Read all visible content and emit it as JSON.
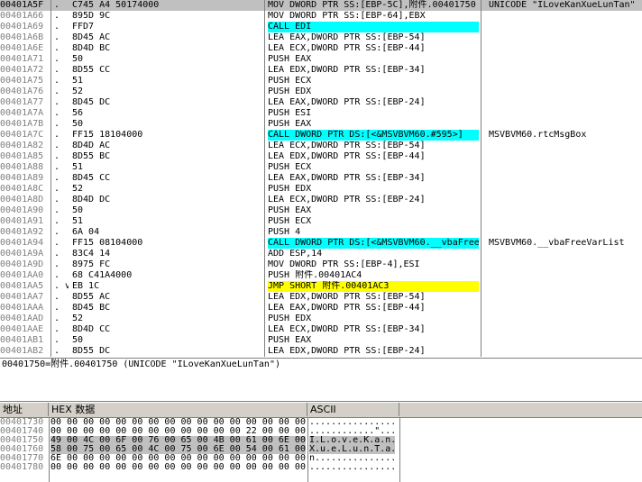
{
  "disasm": {
    "rows": [
      {
        "addr": "00401A5F",
        "mark": ".",
        "hex": "C745 A4 50174000",
        "asm": "MOV DWORD PTR SS:[EBP-5C],附件.00401750",
        "comment": "UNICODE \"ILoveKanXueLunTan\"",
        "selected": true,
        "hl": ""
      },
      {
        "addr": "00401A66",
        "mark": ".",
        "hex": "895D 9C",
        "asm": "MOV DWORD PTR SS:[EBP-64],EBX",
        "comment": "",
        "selected": false,
        "hl": ""
      },
      {
        "addr": "00401A69",
        "mark": ".",
        "hex": "FFD7",
        "asm": "CALL EDI",
        "comment": "",
        "selected": false,
        "hl": "cyan"
      },
      {
        "addr": "00401A6B",
        "mark": ".",
        "hex": "8D45 AC",
        "asm": "LEA EAX,DWORD PTR SS:[EBP-54]",
        "comment": "",
        "selected": false,
        "hl": ""
      },
      {
        "addr": "00401A6E",
        "mark": ".",
        "hex": "8D4D BC",
        "asm": "LEA ECX,DWORD PTR SS:[EBP-44]",
        "comment": "",
        "selected": false,
        "hl": ""
      },
      {
        "addr": "00401A71",
        "mark": ".",
        "hex": "50",
        "asm": "PUSH EAX",
        "comment": "",
        "selected": false,
        "hl": ""
      },
      {
        "addr": "00401A72",
        "mark": ".",
        "hex": "8D55 CC",
        "asm": "LEA EDX,DWORD PTR SS:[EBP-34]",
        "comment": "",
        "selected": false,
        "hl": ""
      },
      {
        "addr": "00401A75",
        "mark": ".",
        "hex": "51",
        "asm": "PUSH ECX",
        "comment": "",
        "selected": false,
        "hl": ""
      },
      {
        "addr": "00401A76",
        "mark": ".",
        "hex": "52",
        "asm": "PUSH EDX",
        "comment": "",
        "selected": false,
        "hl": ""
      },
      {
        "addr": "00401A77",
        "mark": ".",
        "hex": "8D45 DC",
        "asm": "LEA EAX,DWORD PTR SS:[EBP-24]",
        "comment": "",
        "selected": false,
        "hl": ""
      },
      {
        "addr": "00401A7A",
        "mark": ".",
        "hex": "56",
        "asm": "PUSH ESI",
        "comment": "",
        "selected": false,
        "hl": ""
      },
      {
        "addr": "00401A7B",
        "mark": ".",
        "hex": "50",
        "asm": "PUSH EAX",
        "comment": "",
        "selected": false,
        "hl": ""
      },
      {
        "addr": "00401A7C",
        "mark": ".",
        "hex": "FF15 18104000",
        "asm": "CALL DWORD PTR DS:[<&MSVBVM60.#595>]",
        "comment": "MSVBVM60.rtcMsgBox",
        "selected": false,
        "hl": "cyan"
      },
      {
        "addr": "00401A82",
        "mark": ".",
        "hex": "8D4D AC",
        "asm": "LEA ECX,DWORD PTR SS:[EBP-54]",
        "comment": "",
        "selected": false,
        "hl": ""
      },
      {
        "addr": "00401A85",
        "mark": ".",
        "hex": "8D55 BC",
        "asm": "LEA EDX,DWORD PTR SS:[EBP-44]",
        "comment": "",
        "selected": false,
        "hl": ""
      },
      {
        "addr": "00401A88",
        "mark": ".",
        "hex": "51",
        "asm": "PUSH ECX",
        "comment": "",
        "selected": false,
        "hl": ""
      },
      {
        "addr": "00401A89",
        "mark": ".",
        "hex": "8D45 CC",
        "asm": "LEA EAX,DWORD PTR SS:[EBP-34]",
        "comment": "",
        "selected": false,
        "hl": ""
      },
      {
        "addr": "00401A8C",
        "mark": ".",
        "hex": "52",
        "asm": "PUSH EDX",
        "comment": "",
        "selected": false,
        "hl": ""
      },
      {
        "addr": "00401A8D",
        "mark": ".",
        "hex": "8D4D DC",
        "asm": "LEA ECX,DWORD PTR SS:[EBP-24]",
        "comment": "",
        "selected": false,
        "hl": ""
      },
      {
        "addr": "00401A90",
        "mark": ".",
        "hex": "50",
        "asm": "PUSH EAX",
        "comment": "",
        "selected": false,
        "hl": ""
      },
      {
        "addr": "00401A91",
        "mark": ".",
        "hex": "51",
        "asm": "PUSH ECX",
        "comment": "",
        "selected": false,
        "hl": ""
      },
      {
        "addr": "00401A92",
        "mark": ".",
        "hex": "6A 04",
        "asm": "PUSH 4",
        "comment": "",
        "selected": false,
        "hl": ""
      },
      {
        "addr": "00401A94",
        "mark": ".",
        "hex": "FF15 08104000",
        "asm": "CALL DWORD PTR DS:[<&MSVBVM60.__vbaFree",
        "comment": "MSVBVM60.__vbaFreeVarList",
        "selected": false,
        "hl": "cyan"
      },
      {
        "addr": "00401A9A",
        "mark": ".",
        "hex": "83C4 14",
        "asm": "ADD ESP,14",
        "comment": "",
        "selected": false,
        "hl": ""
      },
      {
        "addr": "00401A9D",
        "mark": ".",
        "hex": "8975 FC",
        "asm": "MOV DWORD PTR SS:[EBP-4],ESI",
        "comment": "",
        "selected": false,
        "hl": ""
      },
      {
        "addr": "00401AA0",
        "mark": ".",
        "hex": "68 C41A4000",
        "asm": "PUSH 附件.00401AC4",
        "comment": "",
        "selected": false,
        "hl": ""
      },
      {
        "addr": "00401AA5",
        "mark": ". v",
        "hex": "EB 1C",
        "asm": "JMP SHORT 附件.00401AC3",
        "comment": "",
        "selected": false,
        "hl": "yellow"
      },
      {
        "addr": "00401AA7",
        "mark": ".",
        "hex": "8D55 AC",
        "asm": "LEA EDX,DWORD PTR SS:[EBP-54]",
        "comment": "",
        "selected": false,
        "hl": ""
      },
      {
        "addr": "00401AAA",
        "mark": ".",
        "hex": "8D45 BC",
        "asm": "LEA EAX,DWORD PTR SS:[EBP-44]",
        "comment": "",
        "selected": false,
        "hl": ""
      },
      {
        "addr": "00401AAD",
        "mark": ".",
        "hex": "52",
        "asm": "PUSH EDX",
        "comment": "",
        "selected": false,
        "hl": ""
      },
      {
        "addr": "00401AAE",
        "mark": ".",
        "hex": "8D4D CC",
        "asm": "LEA ECX,DWORD PTR SS:[EBP-34]",
        "comment": "",
        "selected": false,
        "hl": ""
      },
      {
        "addr": "00401AB1",
        "mark": ".",
        "hex": "50",
        "asm": "PUSH EAX",
        "comment": "",
        "selected": false,
        "hl": ""
      },
      {
        "addr": "00401AB2",
        "mark": ".",
        "hex": "8D55 DC",
        "asm": "LEA EDX,DWORD PTR SS:[EBP-24]",
        "comment": "",
        "selected": false,
        "hl": ""
      }
    ]
  },
  "info": {
    "text": "00401750=附件.00401750 (UNICODE \"ILoveKanXueLunTan\")"
  },
  "dump": {
    "headers": {
      "address": "地址",
      "hex": "HEX 数据",
      "ascii": "ASCII"
    },
    "rows": [
      {
        "addr": "00401730",
        "hex": "00 00 00 00 00 00 00 00 00 00 00 00 00 00 00 00",
        "ascii": "................",
        "selected": false
      },
      {
        "addr": "00401740",
        "hex": "00 00 00 00 00 00 00 00 00 00 00 00 22 00 00 00",
        "ascii": "............\"...",
        "selected": false
      },
      {
        "addr": "00401750",
        "hex": "49 00 4C 00 6F 00 76 00 65 00 4B 00 61 00 6E 00",
        "ascii": "I.L.o.v.e.K.a.n.",
        "selected": true
      },
      {
        "addr": "00401760",
        "hex": "58 00 75 00 65 00 4C 00 75 00 6E 00 54 00 61 00",
        "ascii": "X.u.e.L.u.n.T.a.",
        "selected": true
      },
      {
        "addr": "00401770",
        "hex": "6E 00 00 00 00 00 00 00 00 00 00 00 00 00 00 00",
        "ascii": "n...............",
        "selected": false
      },
      {
        "addr": "00401780",
        "hex": "00 00 00 00 00 00 00 00 00 00 00 00 00 00 00 00",
        "ascii": "................",
        "selected": false
      }
    ]
  },
  "colors": {
    "selection": "#c0c0c0",
    "call_highlight": "#00ffff",
    "jump_highlight": "#ffff00",
    "address_text": "#808080"
  }
}
